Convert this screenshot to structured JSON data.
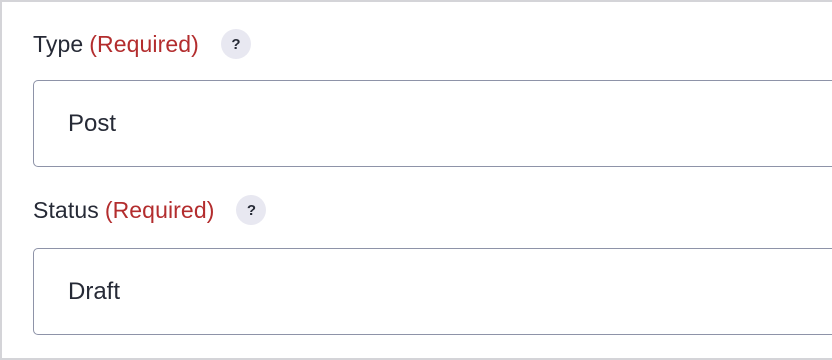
{
  "fields": [
    {
      "label": "Type",
      "required": "(Required)",
      "help": "?",
      "value": "Post"
    },
    {
      "label": "Status",
      "required": "(Required)",
      "help": "?",
      "value": "Draft"
    }
  ],
  "colors": {
    "required": "#b32d2e",
    "text": "#262a36",
    "help_bg": "#e8e8f1",
    "border": "#8e93a8"
  }
}
